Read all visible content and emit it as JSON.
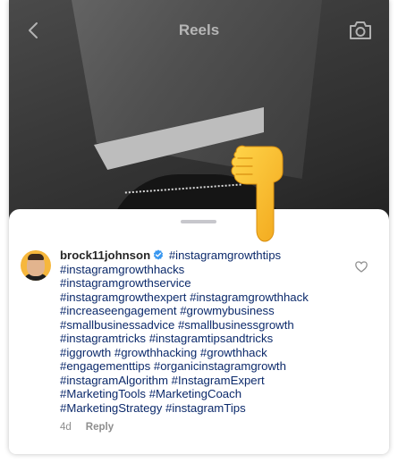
{
  "header": {
    "title": "Reels"
  },
  "comment": {
    "username": "brock11johnson",
    "hashtags": [
      "#instagramgrowthtips",
      "#instagramgrowthhacks",
      "#instagramgrowthservice",
      "#instagramgrowthexpert",
      "#instagramgrowthhack",
      "#increaseengagement",
      "#growmybusiness",
      "#smallbusinessadvice",
      "#smallbusinessgrowth",
      "#instagramtricks",
      "#instagramtipsandtricks",
      "#iggrowth",
      "#growthhacking",
      "#growthhack",
      "#engagementtips",
      "#organicinstagramgrowth",
      "#instagramAlgorithm",
      "#InstagramExpert",
      "#MarketingTools",
      "#MarketingCoach",
      "#MarketingStrategy",
      "#instagramTips"
    ],
    "time": "4d",
    "reply_label": "Reply"
  },
  "icons": {
    "back": "chevron-left-icon",
    "camera": "camera-icon",
    "verified": "verified-badge-icon",
    "heart": "heart-outline-icon",
    "pointer": "pointing-down-hand-emoji"
  },
  "colors": {
    "hashtag": "#0c2a6b",
    "verified": "#3897f0",
    "muted": "#8e8e8e",
    "avatar_bg": "#f6b73c"
  }
}
